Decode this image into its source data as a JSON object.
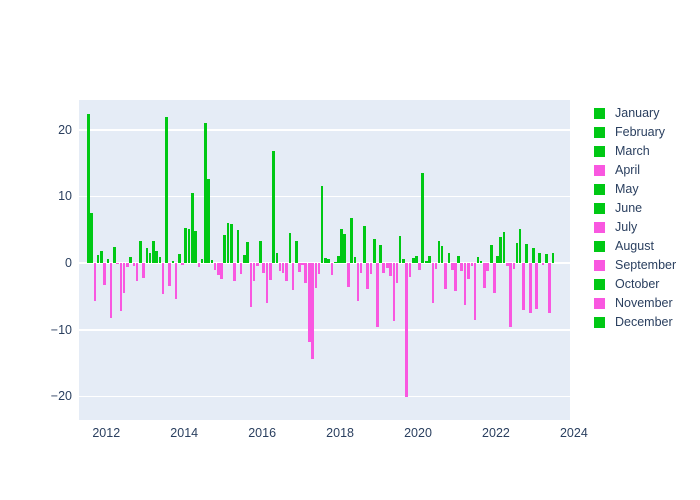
{
  "chart_data": {
    "type": "bar",
    "title": "",
    "xlabel": "",
    "ylabel": "",
    "xlim": [
      2011.3,
      2023.9
    ],
    "ylim": [
      -23.5,
      24.5
    ],
    "grid": true,
    "legend_position": "right",
    "y_ticks": [
      "20",
      "10",
      "0",
      "−10",
      "−20"
    ],
    "y_tick_values": [
      20,
      10,
      0,
      -10,
      -20
    ],
    "x_ticks": [
      "2012",
      "2014",
      "2016",
      "2018",
      "2020",
      "2022",
      "2024"
    ],
    "x_tick_values": [
      2012,
      2014,
      2016,
      2018,
      2020,
      2022,
      2024
    ],
    "positive_color": "#00c814",
    "negative_color": "#f957e0",
    "plot_bgcolor": "#e5ecf6",
    "paper_bgcolor": "#ffffff",
    "gridcolor": "#ffffff",
    "tick_font_color": "#2a3f5f",
    "legend": [
      {
        "label": "January",
        "color": "#00c814"
      },
      {
        "label": "February",
        "color": "#00c814"
      },
      {
        "label": "March",
        "color": "#00c814"
      },
      {
        "label": "April",
        "color": "#f957e0"
      },
      {
        "label": "May",
        "color": "#00c814"
      },
      {
        "label": "June",
        "color": "#00c814"
      },
      {
        "label": "July",
        "color": "#f957e0"
      },
      {
        "label": "August",
        "color": "#00c814"
      },
      {
        "label": "September",
        "color": "#f957e0"
      },
      {
        "label": "October",
        "color": "#00c814"
      },
      {
        "label": "November",
        "color": "#f957e0"
      },
      {
        "label": "December",
        "color": "#00c814"
      }
    ],
    "x": [
      2011.54,
      2011.62,
      2011.71,
      2011.79,
      2011.88,
      2011.96,
      2012.04,
      2012.12,
      2012.21,
      2012.29,
      2012.38,
      2012.46,
      2012.54,
      2012.62,
      2012.71,
      2012.79,
      2012.88,
      2012.96,
      2013.04,
      2013.12,
      2013.21,
      2013.29,
      2013.38,
      2013.46,
      2013.54,
      2013.62,
      2013.71,
      2013.79,
      2013.88,
      2013.96,
      2014.04,
      2014.12,
      2014.21,
      2014.29,
      2014.38,
      2014.46,
      2014.54,
      2014.62,
      2014.71,
      2014.79,
      2014.88,
      2014.96,
      2015.04,
      2015.12,
      2015.21,
      2015.29,
      2015.38,
      2015.46,
      2015.54,
      2015.62,
      2015.71,
      2015.79,
      2015.88,
      2015.96,
      2016.04,
      2016.12,
      2016.21,
      2016.29,
      2016.38,
      2016.46,
      2016.54,
      2016.62,
      2016.71,
      2016.79,
      2016.88,
      2016.96,
      2017.04,
      2017.12,
      2017.21,
      2017.29,
      2017.38,
      2017.46,
      2017.54,
      2017.62,
      2017.71,
      2017.79,
      2017.88,
      2017.96,
      2018.04,
      2018.12,
      2018.21,
      2018.29,
      2018.38,
      2018.46,
      2018.54,
      2018.62,
      2018.71,
      2018.79,
      2018.88,
      2018.96,
      2019.04,
      2019.12,
      2019.21,
      2019.29,
      2019.38,
      2019.46,
      2019.54,
      2019.62,
      2019.71,
      2019.79,
      2019.88,
      2019.96,
      2020.04,
      2020.12,
      2020.21,
      2020.29,
      2020.38,
      2020.46,
      2020.54,
      2020.62,
      2020.71,
      2020.79,
      2020.88,
      2020.96,
      2021.04,
      2021.12,
      2021.21,
      2021.29,
      2021.38,
      2021.46,
      2021.54,
      2021.62,
      2021.71,
      2021.79,
      2021.88,
      2021.96,
      2022.04,
      2022.12,
      2022.21,
      2022.29,
      2022.38,
      2022.46,
      2022.54,
      2022.62,
      2022.71,
      2022.79,
      2022.88,
      2022.96,
      2023.04,
      2023.12,
      2023.21,
      2023.29,
      2023.38,
      2023.46
    ],
    "values": [
      22.4,
      7.6,
      -5.6,
      1.3,
      1.9,
      -3.2,
      0.6,
      -8.2,
      2.4,
      -0.1,
      -7.1,
      -4.4,
      -0.5,
      1.0,
      -0.4,
      -2.7,
      3.4,
      -2.2,
      2.3,
      1.6,
      3.4,
      1.8,
      1.0,
      -4.6,
      22.0,
      -3.4,
      0.4,
      -5.3,
      1.4,
      -0.3,
      5.3,
      5.2,
      10.6,
      4.9,
      -0.5,
      0.6,
      21.1,
      12.6,
      0.5,
      -1.0,
      -1.7,
      -2.3,
      4.2,
      6.0,
      5.9,
      -2.6,
      5.0,
      -1.6,
      1.3,
      3.2,
      -6.6,
      -2.6,
      -0.4,
      3.4,
      -1.5,
      -6.0,
      -2.5,
      16.8,
      1.5,
      -1.2,
      -1.4,
      -2.6,
      4.6,
      -4.0,
      3.3,
      -1.3,
      -0.2,
      -2.9,
      -11.8,
      -14.4,
      -3.7,
      -1.6,
      11.6,
      0.8,
      0.6,
      -1.7,
      0.2,
      1.1,
      5.1,
      4.4,
      -3.5,
      6.8,
      0.9,
      -5.6,
      -1.4,
      5.6,
      -3.9,
      -1.6,
      3.7,
      -9.6,
      2.8,
      -1.5,
      -0.7,
      -1.9,
      -8.7,
      -3.0,
      4.1,
      0.7,
      -20.0,
      -2.1,
      0.8,
      1.1,
      -1.0,
      13.6,
      0.4,
      1.1,
      -5.9,
      -0.8,
      3.3,
      2.6,
      -3.8,
      1.5,
      -1.0,
      -4.2,
      1.1,
      -1.2,
      -6.2,
      -2.3,
      -0.4,
      -8.5,
      0.9,
      0.3,
      -3.7,
      -1.2,
      2.7,
      -4.4,
      1.1,
      4.0,
      4.7,
      -0.4,
      -9.6,
      -0.9,
      3.1,
      5.1,
      -7.0,
      2.9,
      -7.5,
      2.3,
      -6.9,
      1.6,
      -0.3,
      1.4,
      -7.4,
      1.5
    ]
  }
}
